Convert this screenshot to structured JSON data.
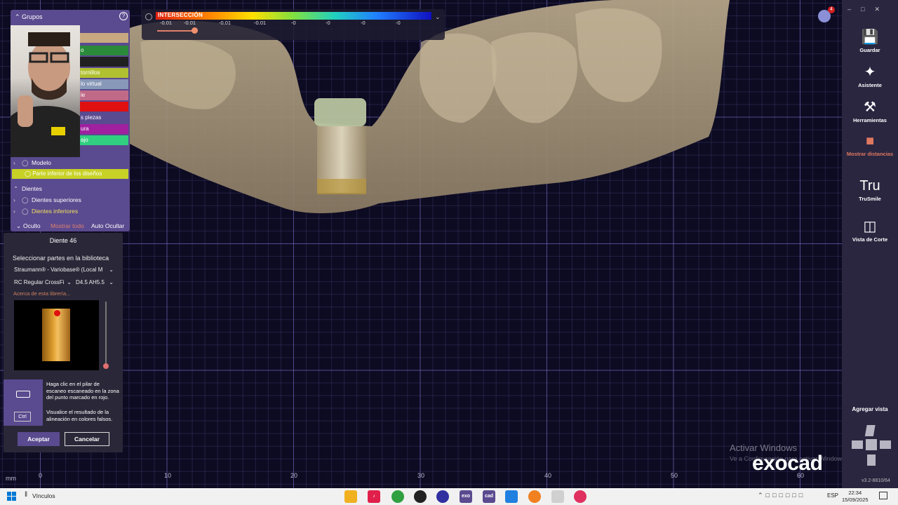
{
  "colorbar": {
    "title": "INTERSECCIÓN",
    "ticks": [
      "-0.01",
      "-0.01",
      "-0.01",
      "-0.01",
      "-0",
      "-0",
      "-0",
      "-0"
    ]
  },
  "notifications": {
    "count": "4"
  },
  "groups": {
    "header": "Grupos",
    "rows": [
      {
        "label": "o",
        "color": "#2a8a3a"
      },
      {
        "label": "tornillos",
        "color": "#b0c030"
      },
      {
        "label": "lo virtual",
        "color": "#8898b8"
      },
      {
        "label": "ie",
        "color": "#c06a88"
      },
      {
        "label": "",
        "color": "#e01010"
      },
      {
        "label": "s piezas",
        "color": "#5a4a8f"
      },
      {
        "label": "ura",
        "color": "#a020a0"
      },
      {
        "label": "ajo",
        "color": "#30d080"
      }
    ],
    "tree": {
      "modelo": "Modelo",
      "parte_inferior": "Parte inferior de los diseños",
      "dientes": "Dientes",
      "dientes_superiores": "Dientes superiores",
      "dientes_inferiores": "Dientes inferiores"
    },
    "oculto": "Oculto",
    "mostrar_todo": "Mostrar todo",
    "auto_ocultar": "Auto Ocultar"
  },
  "tooth_panel": {
    "title": "Diente 46",
    "library_label": "Seleccionar partes en la biblioteca",
    "library_select": "Straumann® - Variobase® (Local M",
    "connection_select": "RC Regular CrossFi",
    "size_select": "D4.5 AH5.5",
    "about_link": "Acerca de esta librería...",
    "ctrl_key": "Ctrl",
    "hint_1": "Haga clic en el pilar de escaneo escaneado en la zona del punto marcado en rojo.",
    "hint_2": "Visualice el resultado de la alineación en colores falsos.",
    "accept": "Aceptar",
    "cancel": "Cancelar"
  },
  "sidebar": {
    "items": [
      {
        "label": "Guardar",
        "icon": "save-icon"
      },
      {
        "label": "Asistente",
        "icon": "wizard-icon"
      },
      {
        "label": "Herramientas",
        "icon": "tools-icon"
      },
      {
        "label": "Mostrar distancias",
        "icon": "distance-icon"
      },
      {
        "label": "TruSmile",
        "icon": "trusmile-icon"
      },
      {
        "label": "Vista de Corte",
        "icon": "section-view-icon"
      }
    ],
    "add_view": "Agregar vista",
    "version": "v3.2-8810/64"
  },
  "ruler": {
    "unit": "mm",
    "labels": [
      "0",
      "10",
      "20",
      "30",
      "40",
      "50",
      "60"
    ]
  },
  "watermark": {
    "title": "Activar Windows",
    "subtitle": "Ve a Configuración para activar Windows."
  },
  "logo": "exocad",
  "taskbar": {
    "search_label": "Vínculos",
    "lang": "ESP",
    "time": "22:34",
    "date": "15/09/2025"
  }
}
